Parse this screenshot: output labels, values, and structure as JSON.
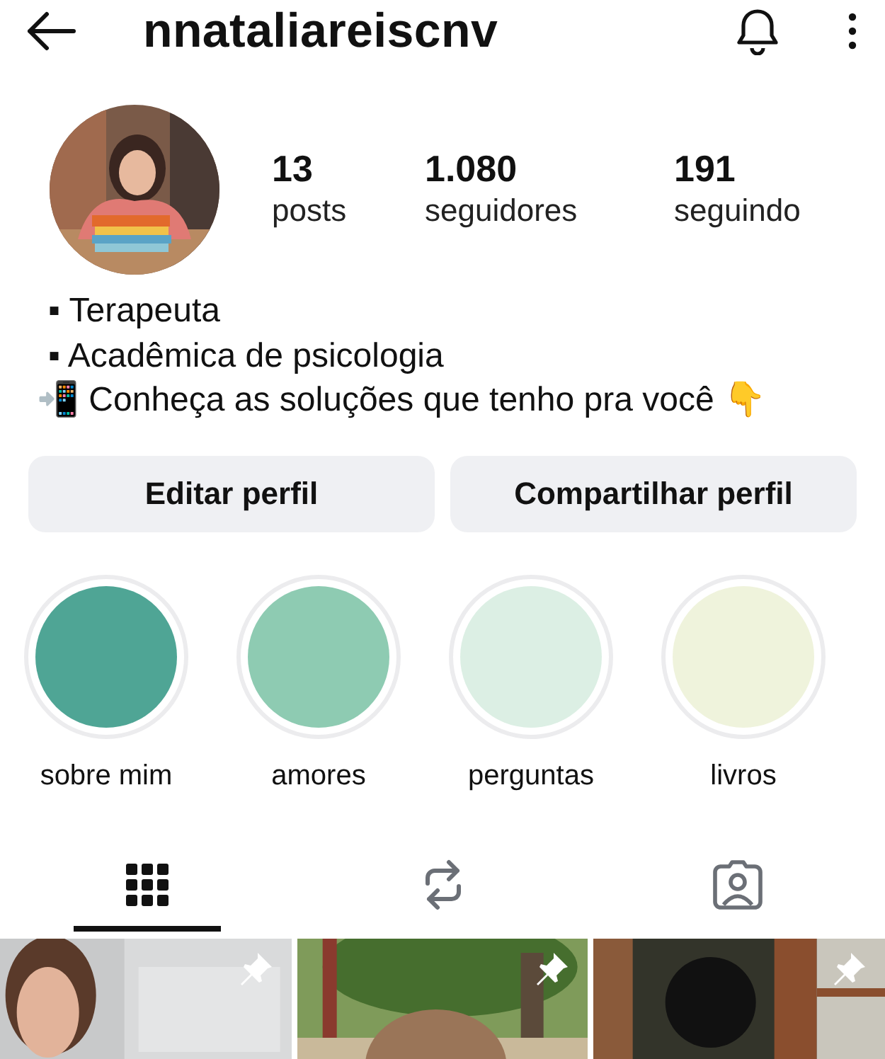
{
  "header": {
    "username": "nnataliareiscnv"
  },
  "stats": [
    {
      "value": "13",
      "label": "posts"
    },
    {
      "value": "1.080",
      "label": "seguidores"
    },
    {
      "value": "191",
      "label": "seguindo"
    }
  ],
  "bio": [
    "▪ Terapeuta",
    "▪ Acadêmica de psicologia",
    "📲 Conheça as soluções que tenho pra você 👇"
  ],
  "buttons": [
    "Editar perfil",
    "Compartilhar perfil"
  ],
  "highlights": [
    {
      "name": "sobre mim",
      "color": "#4fa595"
    },
    {
      "name": "amores",
      "color": "#8ecbb2"
    },
    {
      "name": "perguntas",
      "color": "#dcefe4"
    },
    {
      "name": "livros",
      "color": "#eff3dc"
    }
  ],
  "tabs": [
    {
      "kind": "grid",
      "selected": true
    },
    {
      "kind": "reposts",
      "selected": false
    },
    {
      "kind": "tagged",
      "selected": false
    }
  ],
  "posts": [
    {
      "kind": "picture",
      "pinned": true
    },
    {
      "kind": "picture",
      "pinned": true
    },
    {
      "kind": "picture",
      "pinned": true
    }
  ]
}
